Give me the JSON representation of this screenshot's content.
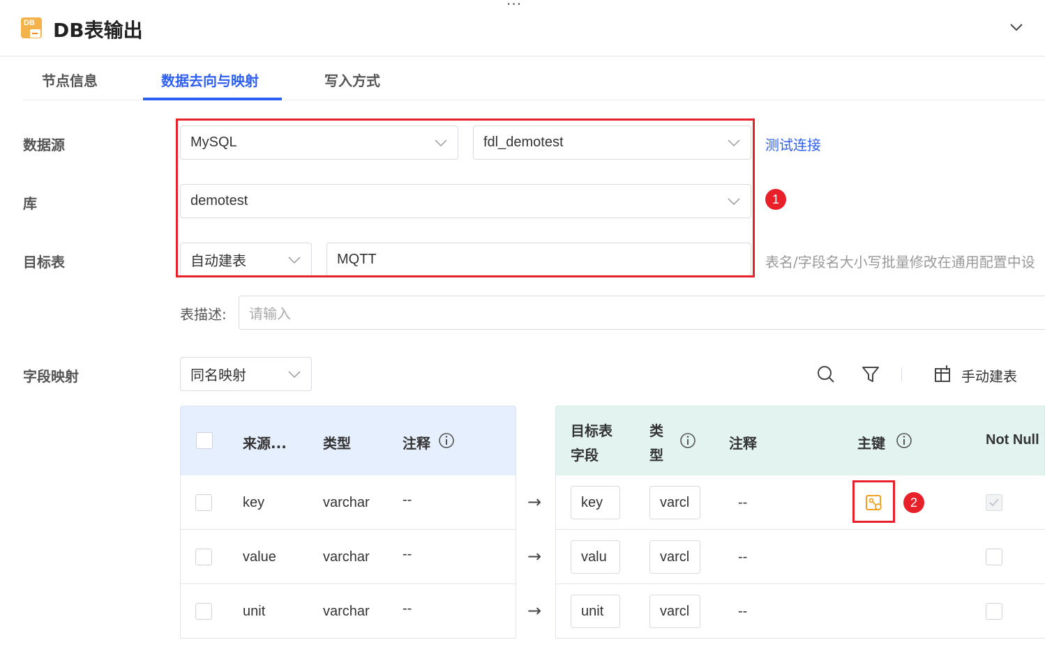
{
  "header": {
    "dots": "···",
    "icon_text": "DB",
    "title": "DB表输出"
  },
  "tabs": [
    {
      "label": "节点信息",
      "active": false
    },
    {
      "label": "数据去向与映射",
      "active": true
    },
    {
      "label": "写入方式",
      "active": false
    }
  ],
  "form": {
    "datasource_label": "数据源",
    "datasource_type": "MySQL",
    "datasource_conn": "fdl_demotest",
    "test_connection": "测试连接",
    "db_label": "库",
    "db_value": "demotest",
    "target_label": "目标表",
    "target_mode": "自动建表",
    "target_table": "MQTT",
    "target_hint": "表名/字段名大小写批量修改在通用配置中设",
    "desc_label": "表描述:",
    "desc_placeholder": "请输入",
    "mapping_label": "字段映射",
    "mapping_mode": "同名映射",
    "manual_create": "手动建表"
  },
  "annotations": {
    "badge1": "1",
    "badge2": "2"
  },
  "source_table": {
    "headers": [
      "来源...",
      "类型",
      "注释"
    ],
    "rows": [
      {
        "name": "key",
        "type": "varchar",
        "comment": "--"
      },
      {
        "name": "value",
        "type": "varchar",
        "comment": "--"
      },
      {
        "name": "unit",
        "type": "varchar",
        "comment": "--"
      }
    ]
  },
  "target_table": {
    "headers": {
      "field_1": "目标表",
      "field_2": "字段",
      "type_1": "类",
      "type_2": "型",
      "comment": "注释",
      "pk": "主键",
      "notnull": "Not Null"
    },
    "rows": [
      {
        "field": "key",
        "type": "varcl",
        "comment": "--",
        "primary_key": true,
        "not_null": true
      },
      {
        "field": "valu",
        "type": "varcl",
        "comment": "--",
        "primary_key": false,
        "not_null": false
      },
      {
        "field": "unit",
        "type": "varcl",
        "comment": "--",
        "primary_key": false,
        "not_null": false
      }
    ]
  },
  "colors": {
    "accent": "#2f5ff0",
    "highlight": "#e7202a",
    "pk_icon": "#f0a020",
    "left_head_bg": "#e6effd",
    "right_head_bg": "#e3f4f0"
  }
}
